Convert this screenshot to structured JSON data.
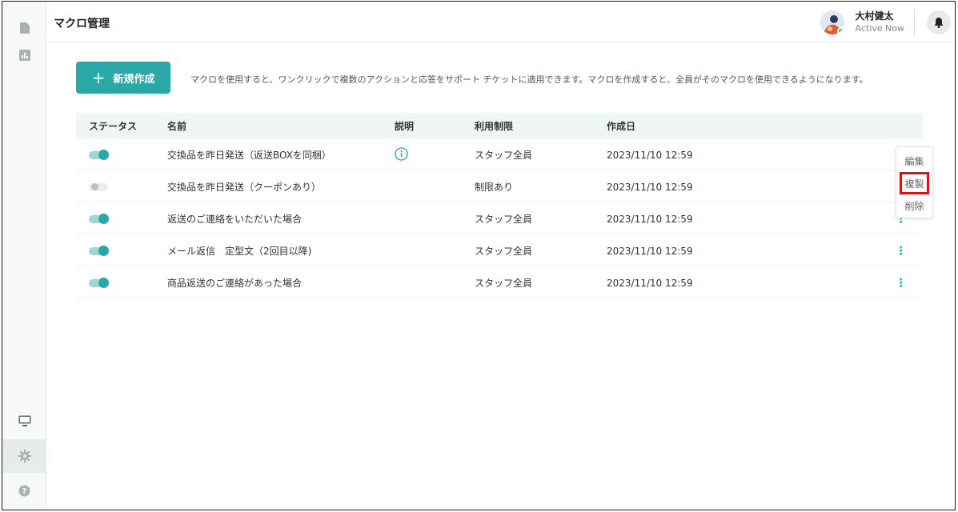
{
  "header": {
    "title": "マクロ管理",
    "user_name": "大村健太",
    "user_status": "Active Now"
  },
  "sidebar": {
    "items": [
      {
        "icon": "document-icon"
      },
      {
        "icon": "chart-icon"
      },
      {
        "icon": "monitor-icon"
      },
      {
        "icon": "gear-icon"
      },
      {
        "icon": "help-icon"
      }
    ]
  },
  "toolbar": {
    "new_button_plus": "+",
    "new_button_label": "新規作成",
    "description": "マクロを使用すると、ワンクリックで複数のアクションと応答をサポート チケットに適用できます。マクロを作成すると、全員がそのマクロを使用できるようになります。"
  },
  "table": {
    "headers": [
      "ステータス",
      "名前",
      "説明",
      "利用制限",
      "作成日"
    ],
    "rows": [
      {
        "enabled": true,
        "name": "交換品を昨日発送（返送BOXを同梱）",
        "has_description": true,
        "limit": "スタッフ全員",
        "created": "2023/11/10 12:59"
      },
      {
        "enabled": false,
        "name": "交換品を昨日発送（クーポンあり）",
        "has_description": false,
        "limit": "制限あり",
        "created": "2023/11/10 12:59"
      },
      {
        "enabled": true,
        "name": "返送のご連絡をいただいた場合",
        "has_description": false,
        "limit": "スタッフ全員",
        "created": "2023/11/10 12:59"
      },
      {
        "enabled": true,
        "name": "メール返信　定型文（2回目以降)",
        "has_description": false,
        "limit": "スタッフ全員",
        "created": "2023/11/10 12:59"
      },
      {
        "enabled": true,
        "name": "商品返送のご連絡があった場合",
        "has_description": false,
        "limit": "スタッフ全員",
        "created": "2023/11/10 12:59"
      }
    ],
    "row_menu_glyph": "⋮"
  },
  "context_menu": {
    "items": [
      "編集",
      "複製",
      "削除"
    ],
    "highlighted": "複製"
  },
  "colors": {
    "accent": "#2aa8a8",
    "highlight_border": "#d41418",
    "table_header_bg": "#eef6f6"
  }
}
